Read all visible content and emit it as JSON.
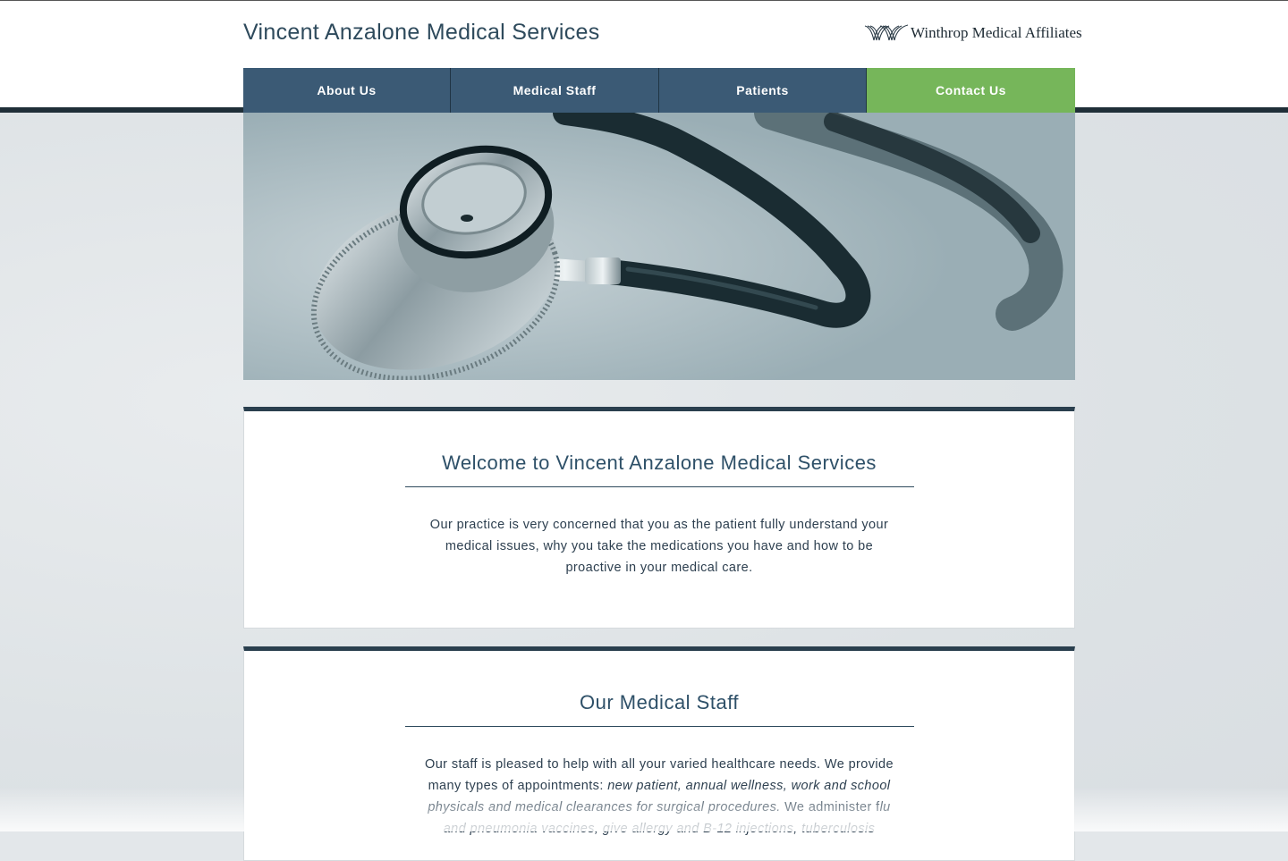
{
  "header": {
    "site_title": "Vincent Anzalone Medical Services",
    "partner_name": "Winthrop Medical Affiliates",
    "partner_logo_icon": "winthrop-wave-logo-icon"
  },
  "nav": {
    "items": [
      {
        "label": "About Us",
        "active": false
      },
      {
        "label": "Medical Staff",
        "active": false
      },
      {
        "label": "Patients",
        "active": false
      },
      {
        "label": "Contact Us",
        "active": true
      }
    ]
  },
  "hero": {
    "image": "stethoscope-image"
  },
  "sections": [
    {
      "title": "Welcome to Vincent Anzalone Medical Services",
      "body": "Our practice is very concerned that you as the patient fully understand your medical issues, why you take the medications you have and how to be proactive in your medical care."
    },
    {
      "title": "Our Medical Staff",
      "body_start": "Our staff is pleased to help with all your varied healthcare needs. We provide many types of appointments: ",
      "body_italic_1": "new patient, annual wellness, work and school physicals and medical clearances for surgical procedures.",
      "body_middle": " We administer f",
      "body_italic_2": "lu and pneumonia vaccines, give allergy and B-12 injections, tuberculosis"
    }
  ],
  "colors": {
    "nav_blue": "#3b5a75",
    "nav_active_green": "#76b65a",
    "title_blue": "#2e5068",
    "dark_bar": "#1f2f38"
  }
}
